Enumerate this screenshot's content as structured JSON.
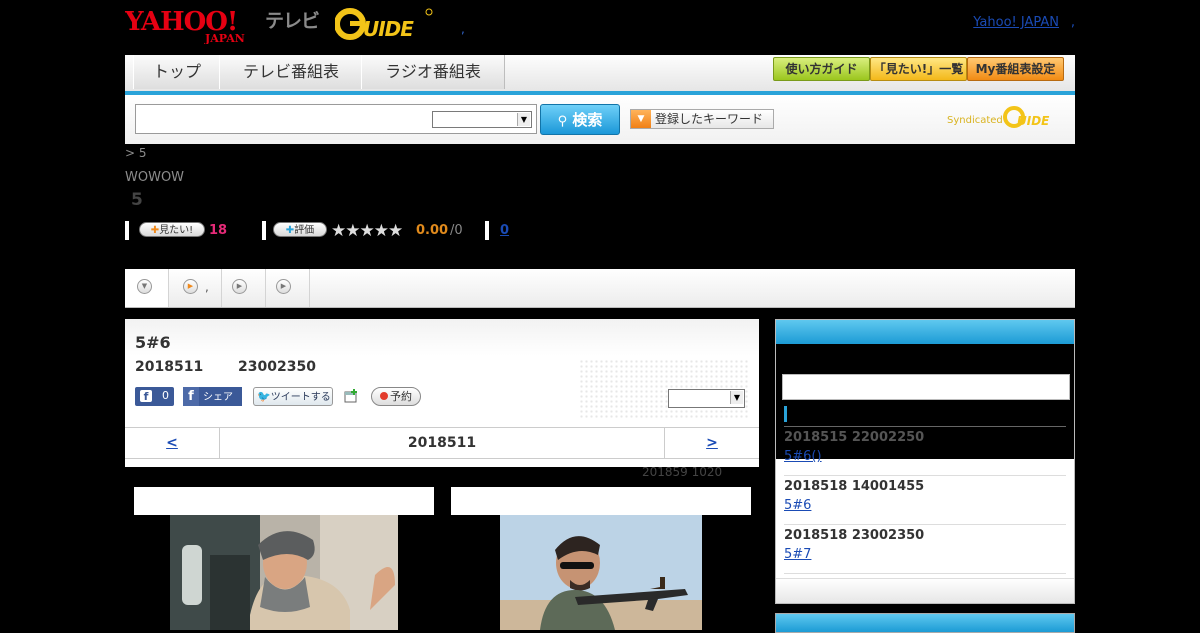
{
  "header": {
    "brand_yahoo": "YAHOO!",
    "brand_japan": "JAPAN",
    "brand_tv": "テレビ",
    "brand_gguide": "G GUIDE",
    "dot": ",",
    "yahoo_japan_link": "Yahoo! JAPAN",
    "yahoo_japan_dot": ","
  },
  "nav": {
    "tabs": [
      {
        "label": "トップ"
      },
      {
        "label": "テレビ番組表"
      },
      {
        "label": "ラジオ番組表"
      }
    ],
    "buttons": [
      {
        "label": "使い方ガイド",
        "color": "#9bc61e"
      },
      {
        "label": "「見たい!」一覧",
        "color": "#f3b81a"
      },
      {
        "label": "My番組表設定",
        "color": "#f18b14"
      }
    ]
  },
  "search": {
    "input_value": "",
    "select_value": "",
    "button_label": "検索",
    "keywords_label": "登録したキーワード",
    "syndicated_label": "Syndicated",
    "syndicated_brand": "G GUIDE"
  },
  "program": {
    "breadcrumb": ">  5",
    "channel": "WOWOW",
    "title": "5",
    "want_button": "見たい!",
    "want_count": "18",
    "rate_button": "評価",
    "stars": "★★★★★",
    "score": "0.00",
    "score_total": "/0",
    "comments": "0",
    "accent_pink": "#e62a78",
    "accent_orange": "#e08a1c"
  },
  "tabs": {
    "items": [
      {
        "name": "tab-1",
        "dot": ""
      },
      {
        "name": "tab-2",
        "dot": ","
      },
      {
        "name": "tab-3",
        "dot": ""
      },
      {
        "name": "tab-4",
        "dot": ""
      }
    ]
  },
  "episode": {
    "title": "5#6",
    "date": "2018511",
    "time": "23002350",
    "fb_count": "0",
    "fb_share": "シェア",
    "tweet": "ツイートする",
    "reserve": "予約",
    "select_value": "",
    "prev": "<",
    "next": ">",
    "nav_date": "2018511",
    "updated": "201859  1020"
  },
  "sidebar": {
    "items": [
      {
        "time": "2018515  22002250",
        "link": "5#6()     "
      },
      {
        "time": "2018518  14001455",
        "link": "5#6   "
      },
      {
        "time": "2018518  23002350",
        "link": "5#7   "
      }
    ]
  }
}
